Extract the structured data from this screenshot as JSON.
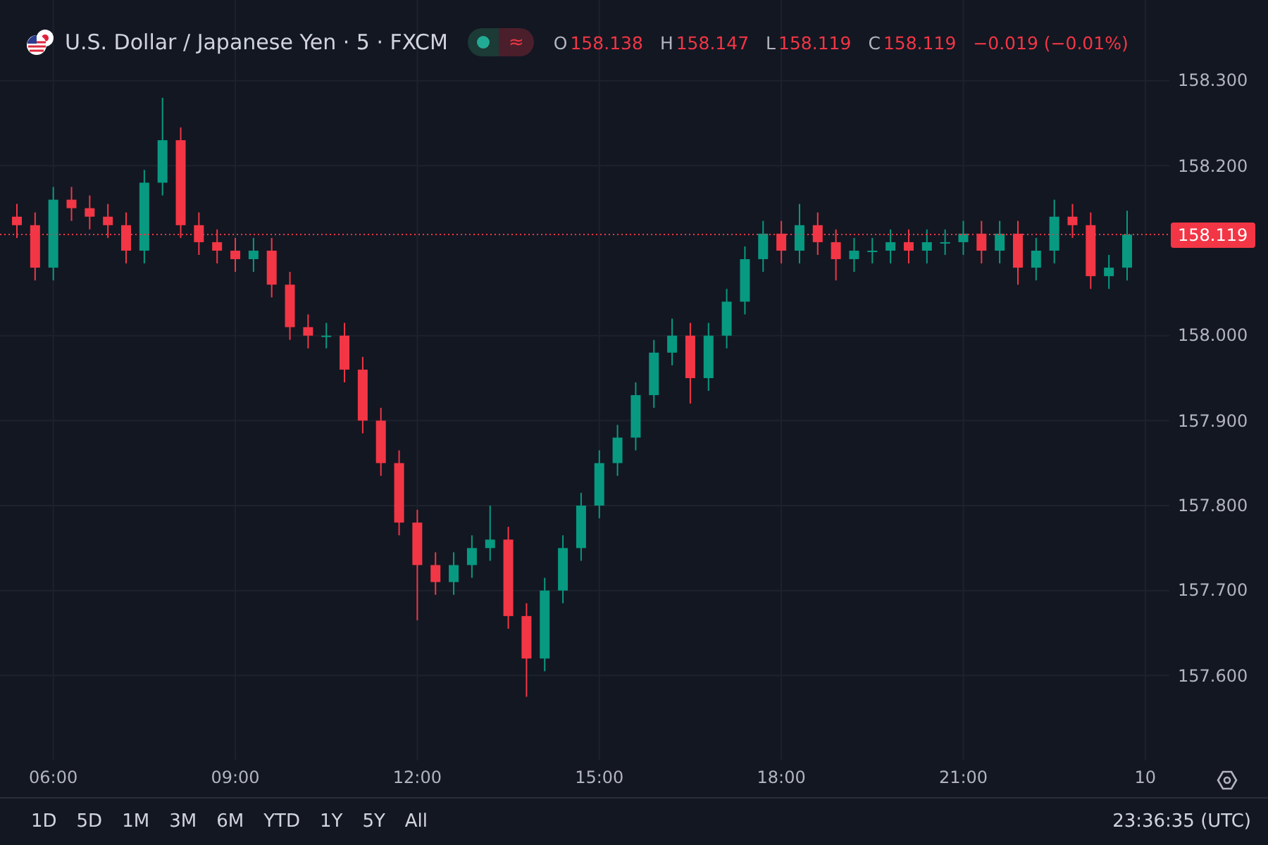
{
  "header": {
    "symbol": "U.S. Dollar / Japanese Yen · 5 · FXCM",
    "status_glyph": "≈",
    "ohlc": [
      {
        "label": "O",
        "value": "158.138"
      },
      {
        "label": "H",
        "value": "158.147"
      },
      {
        "label": "L",
        "value": "158.119"
      },
      {
        "label": "C",
        "value": "158.119"
      }
    ],
    "change": "−0.019 (−0.01%)"
  },
  "chart": {
    "last_price": "158.119",
    "chart_data": {
      "type": "candlestick",
      "ylim": [
        157.5,
        158.395
      ],
      "grid": true,
      "ref_lines": [
        {
          "axis": "y",
          "value": 158.119,
          "color": "#f23645"
        }
      ],
      "categories": [
        null,
        null,
        "06:00",
        null,
        null,
        null,
        null,
        null,
        null,
        null,
        null,
        null,
        "09:00",
        null,
        null,
        null,
        null,
        null,
        null,
        null,
        null,
        null,
        "12:00",
        null,
        null,
        null,
        null,
        null,
        null,
        null,
        null,
        null,
        "15:00",
        null,
        null,
        null,
        null,
        null,
        null,
        null,
        null,
        null,
        "18:00",
        null,
        null,
        null,
        null,
        null,
        null,
        null,
        null,
        null,
        "21:00",
        null,
        null,
        null,
        null,
        null,
        null,
        null,
        null,
        null,
        "10",
        null
      ],
      "ohlc": [
        [
          158.14,
          158.155,
          158.115,
          158.13
        ],
        [
          158.13,
          158.145,
          158.065,
          158.08
        ],
        [
          158.08,
          158.175,
          158.065,
          158.16
        ],
        [
          158.16,
          158.175,
          158.135,
          158.15
        ],
        [
          158.15,
          158.165,
          158.125,
          158.14
        ],
        [
          158.14,
          158.155,
          158.115,
          158.13
        ],
        [
          158.13,
          158.145,
          158.085,
          158.1
        ],
        [
          158.1,
          158.195,
          158.085,
          158.18
        ],
        [
          158.18,
          158.28,
          158.165,
          158.23
        ],
        [
          158.23,
          158.245,
          158.115,
          158.13
        ],
        [
          158.13,
          158.145,
          158.095,
          158.11
        ],
        [
          158.11,
          158.125,
          158.085,
          158.1
        ],
        [
          158.1,
          158.115,
          158.075,
          158.09
        ],
        [
          158.09,
          158.115,
          158.075,
          158.1
        ],
        [
          158.1,
          158.115,
          158.045,
          158.06
        ],
        [
          158.06,
          158.075,
          157.995,
          158.01
        ],
        [
          158.01,
          158.025,
          157.985,
          158.0
        ],
        [
          158.0,
          158.015,
          157.985,
          158.0
        ],
        [
          158.0,
          158.015,
          157.945,
          157.96
        ],
        [
          157.96,
          157.975,
          157.885,
          157.9
        ],
        [
          157.9,
          157.915,
          157.835,
          157.85
        ],
        [
          157.85,
          157.865,
          157.765,
          157.78
        ],
        [
          157.78,
          157.795,
          157.665,
          157.73
        ],
        [
          157.73,
          157.745,
          157.695,
          157.71
        ],
        [
          157.71,
          157.745,
          157.695,
          157.73
        ],
        [
          157.73,
          157.765,
          157.715,
          157.75
        ],
        [
          157.75,
          157.8,
          157.735,
          157.76
        ],
        [
          157.76,
          157.775,
          157.655,
          157.67
        ],
        [
          157.67,
          157.685,
          157.575,
          157.62
        ],
        [
          157.62,
          157.715,
          157.605,
          157.7
        ],
        [
          157.7,
          157.765,
          157.685,
          157.75
        ],
        [
          157.75,
          157.815,
          157.735,
          157.8
        ],
        [
          157.8,
          157.865,
          157.785,
          157.85
        ],
        [
          157.85,
          157.895,
          157.835,
          157.88
        ],
        [
          157.88,
          157.945,
          157.865,
          157.93
        ],
        [
          157.93,
          157.995,
          157.915,
          157.98
        ],
        [
          157.98,
          158.02,
          157.965,
          158.0
        ],
        [
          158.0,
          158.015,
          157.92,
          157.95
        ],
        [
          157.95,
          158.015,
          157.935,
          158.0
        ],
        [
          158.0,
          158.055,
          157.985,
          158.04
        ],
        [
          158.04,
          158.105,
          158.025,
          158.09
        ],
        [
          158.09,
          158.135,
          158.075,
          158.12
        ],
        [
          158.12,
          158.135,
          158.085,
          158.1
        ],
        [
          158.1,
          158.155,
          158.085,
          158.13
        ],
        [
          158.13,
          158.145,
          158.095,
          158.11
        ],
        [
          158.11,
          158.125,
          158.065,
          158.09
        ],
        [
          158.09,
          158.115,
          158.075,
          158.1
        ],
        [
          158.1,
          158.115,
          158.085,
          158.1
        ],
        [
          158.1,
          158.125,
          158.085,
          158.11
        ],
        [
          158.11,
          158.125,
          158.085,
          158.1
        ],
        [
          158.1,
          158.125,
          158.085,
          158.11
        ],
        [
          158.11,
          158.125,
          158.095,
          158.11
        ],
        [
          158.11,
          158.135,
          158.095,
          158.12
        ],
        [
          158.12,
          158.135,
          158.085,
          158.1
        ],
        [
          158.1,
          158.135,
          158.085,
          158.12
        ],
        [
          158.12,
          158.135,
          158.06,
          158.08
        ],
        [
          158.08,
          158.115,
          158.065,
          158.1
        ],
        [
          158.1,
          158.16,
          158.085,
          158.14
        ],
        [
          158.14,
          158.155,
          158.115,
          158.13
        ],
        [
          158.13,
          158.145,
          158.055,
          158.07
        ],
        [
          158.07,
          158.095,
          158.055,
          158.08
        ],
        [
          158.08,
          158.147,
          158.065,
          158.119
        ],
        null,
        null
      ],
      "yticks": [
        {
          "value": 158.3,
          "label": "158.300"
        },
        {
          "value": 158.2,
          "label": "158.200"
        },
        {
          "value": 158.0,
          "label": "158.000"
        },
        {
          "value": 157.9,
          "label": "157.900"
        },
        {
          "value": 157.8,
          "label": "157.800"
        },
        {
          "value": 157.7,
          "label": "157.700"
        },
        {
          "value": 157.6,
          "label": "157.600"
        }
      ]
    }
  },
  "ranges": [
    "1D",
    "5D",
    "1M",
    "3M",
    "6M",
    "YTD",
    "1Y",
    "5Y",
    "All"
  ],
  "clock": "23:36:35 (UTC)"
}
